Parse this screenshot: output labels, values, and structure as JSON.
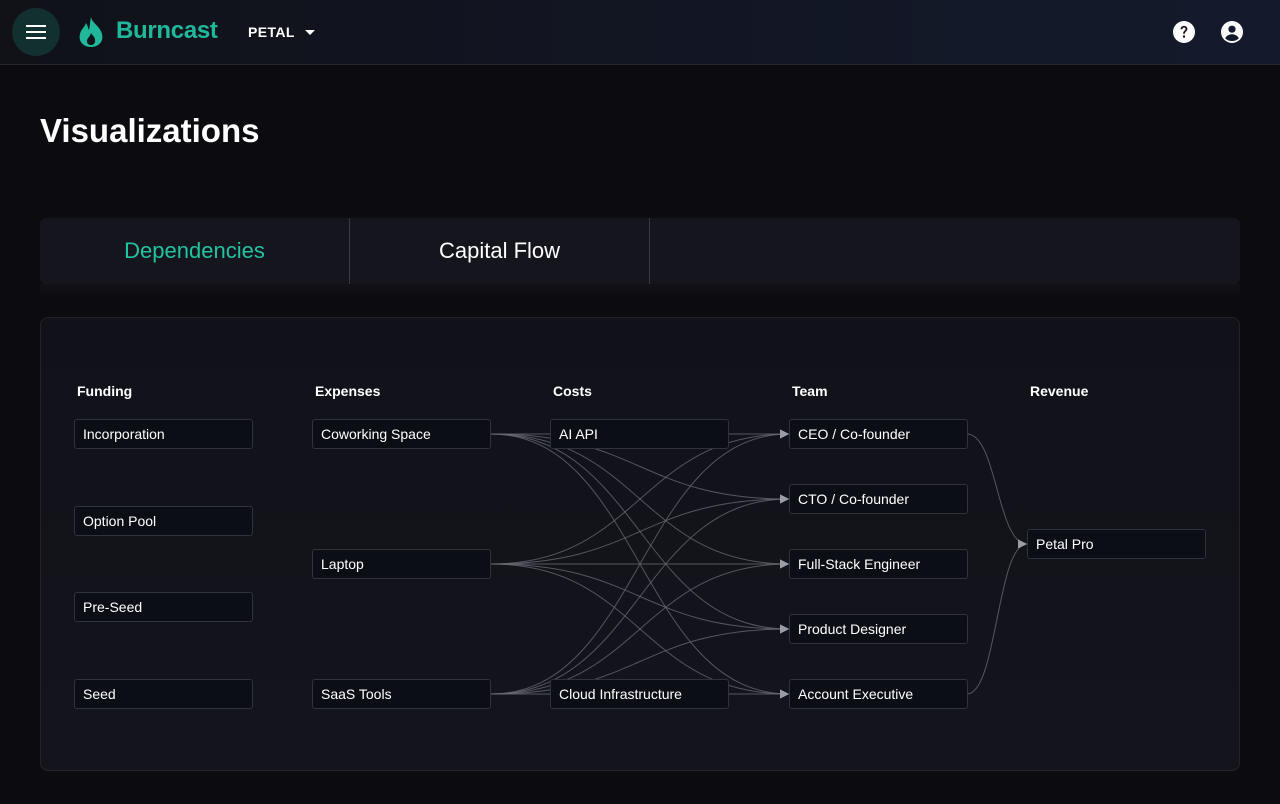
{
  "app": {
    "brand": "Burncast",
    "org": "PETAL"
  },
  "page": {
    "title": "Visualizations"
  },
  "tabs": [
    {
      "label": "Dependencies",
      "active": true
    },
    {
      "label": "Capital Flow",
      "active": false
    }
  ],
  "graph": {
    "columns": [
      "Funding",
      "Expenses",
      "Costs",
      "Team",
      "Revenue"
    ],
    "funding": [
      "Incorporation",
      "Option Pool",
      "Pre-Seed",
      "Seed"
    ],
    "expenses": [
      "Coworking Space",
      "Laptop",
      "SaaS Tools"
    ],
    "costs": [
      "AI API",
      "Cloud Infrastructure"
    ],
    "team": [
      "CEO / Co-founder",
      "CTO / Co-founder",
      "Full-Stack Engineer",
      "Product Designer",
      "Account Executive"
    ],
    "revenue": [
      "Petal Pro"
    ]
  },
  "colors": {
    "accent": "#22c3a0",
    "brand": "#1fb89b",
    "edge": "#6b6e76"
  },
  "icons": {
    "menu": "menu-icon",
    "logo": "flame-logo-icon",
    "help": "help-icon",
    "account": "account-icon"
  }
}
